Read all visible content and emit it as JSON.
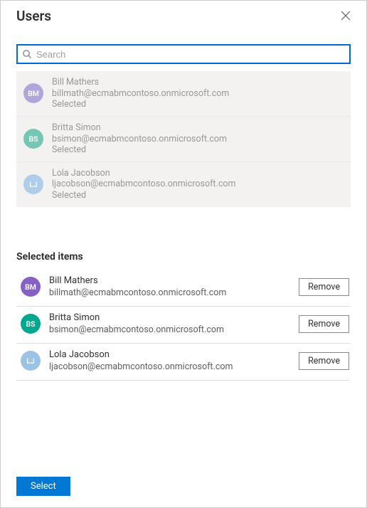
{
  "header": {
    "title": "Users"
  },
  "search": {
    "placeholder": "Search",
    "value": ""
  },
  "results": [
    {
      "initials": "BM",
      "name": "Bill Mathers",
      "email": "billmath@ecmabmcontoso.onmicrosoft.com",
      "status": "Selected",
      "avatar_color": "#a798d9"
    },
    {
      "initials": "BS",
      "name": "Britta Simon",
      "email": "bsimon@ecmabmcontoso.onmicrosoft.com",
      "status": "Selected",
      "avatar_color": "#5ec0a8"
    },
    {
      "initials": "LJ",
      "name": "Lola Jacobson",
      "email": "ljacobson@ecmabmcontoso.onmicrosoft.com",
      "status": "Selected",
      "avatar_color": "#a3c7ea"
    }
  ],
  "selected_heading": "Selected items",
  "selected": [
    {
      "initials": "BM",
      "name": "Bill Mathers",
      "email": "billmath@ecmabmcontoso.onmicrosoft.com",
      "avatar_color": "#8661c5",
      "remove_label": "Remove"
    },
    {
      "initials": "BS",
      "name": "Britta Simon",
      "email": "bsimon@ecmabmcontoso.onmicrosoft.com",
      "avatar_color": "#00a88f",
      "remove_label": "Remove"
    },
    {
      "initials": "LJ",
      "name": "Lola Jacobson",
      "email": "ljacobson@ecmabmcontoso.onmicrosoft.com",
      "avatar_color": "#9bc3e6",
      "remove_label": "Remove"
    }
  ],
  "footer": {
    "select_label": "Select"
  }
}
